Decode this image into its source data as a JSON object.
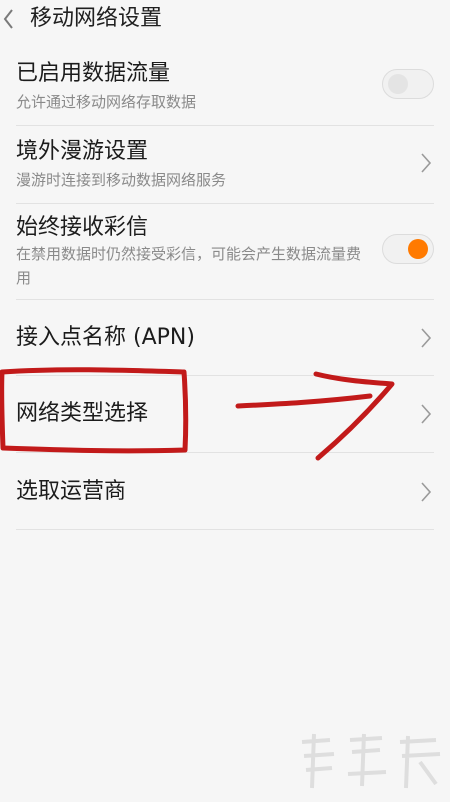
{
  "header": {
    "title": "移动网络设置",
    "back_icon": "chevron-left-icon"
  },
  "settings": [
    {
      "title": "已启用数据流量",
      "subtitle": "允许通过移动网络存取数据",
      "control": "switch",
      "state": "off"
    },
    {
      "title": "境外漫游设置",
      "subtitle": "漫游时连接到移动数据网络服务",
      "control": "chevron"
    },
    {
      "title": "始终接收彩信",
      "subtitle": "在禁用数据时仍然接受彩信，可能会产生数据流量费用",
      "control": "switch",
      "state": "on"
    },
    {
      "title": "接入点名称 (APN)",
      "control": "chevron"
    },
    {
      "title": "网络类型选择",
      "control": "chevron"
    },
    {
      "title": "选取运营商",
      "control": "chevron"
    }
  ],
  "colors": {
    "accent": "#ff7a00",
    "annotation": "#c21a1a"
  }
}
